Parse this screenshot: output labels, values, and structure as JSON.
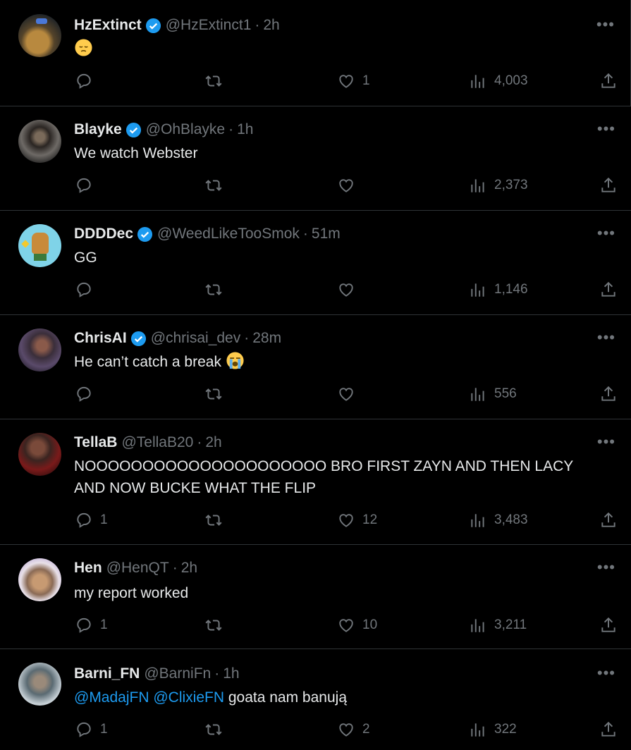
{
  "tweets": [
    {
      "name": "HzExtinct",
      "verified": true,
      "handle": "@HzExtinct1",
      "time": "2h",
      "text": "",
      "emoji": "pensive",
      "replies": "",
      "likes": "1",
      "views": "4,003"
    },
    {
      "name": "Blayke",
      "verified": true,
      "handle": "@OhBlayke",
      "time": "1h",
      "text": "We watch Webster",
      "replies": "",
      "likes": "",
      "views": "2,373"
    },
    {
      "name": "DDDDec",
      "verified": true,
      "handle": "@WeedLikeTooSmok",
      "time": "51m",
      "text": "GG",
      "replies": "",
      "likes": "",
      "views": "1,146"
    },
    {
      "name": "ChrisAI",
      "verified": true,
      "handle": "@chrisai_dev",
      "time": "28m",
      "text": "He can’t catch a break",
      "emoji": "crying",
      "replies": "",
      "likes": "",
      "views": "556"
    },
    {
      "name": "TellaB",
      "verified": false,
      "handle": "@TellaB20",
      "time": "2h",
      "text": "NOOOOOOOOOOOOOOOOOOOOO BRO FIRST ZAYN AND THEN LACY AND NOW BUCKE WHAT THE FLIP",
      "replies": "1",
      "likes": "12",
      "views": "3,483"
    },
    {
      "name": "Hen",
      "verified": false,
      "handle": "@HenQT",
      "time": "2h",
      "text": "my report worked",
      "replies": "1",
      "likes": "10",
      "views": "3,211"
    },
    {
      "name": "Barni_FN",
      "verified": false,
      "handle": "@BarniFn",
      "time": "1h",
      "mentions": [
        "@MadajFN",
        "@ClixieFN"
      ],
      "text": "goata nam banują",
      "replies": "1",
      "likes": "2",
      "views": "322"
    }
  ],
  "colors": {
    "background": "#000000",
    "text": "#e7e9ea",
    "muted": "#71767b",
    "accent": "#1d9bf0",
    "divider": "#2f3336"
  },
  "icons": {
    "reply": "reply-icon",
    "retweet": "retweet-icon",
    "like": "heart-icon",
    "views": "views-icon",
    "share": "share-icon",
    "more": "more-icon",
    "verified": "verified-badge-icon"
  }
}
